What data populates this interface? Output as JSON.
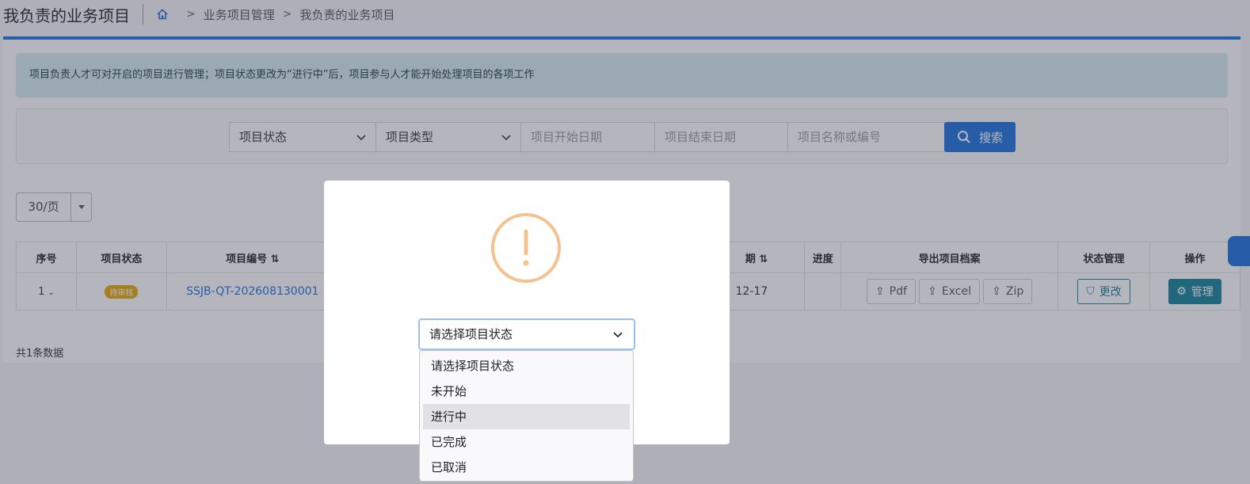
{
  "header": {
    "title": "我负责的业务项目",
    "breadcrumb": [
      "业务项目管理",
      "我负责的业务项目"
    ]
  },
  "notice": "项目负责人才可对开启的项目进行管理；项目状态更改为“进行中”后，项目参与人才能开始处理项目的各项工作",
  "filters": {
    "status_select": "项目状态",
    "type_select": "项目类型",
    "start_date_placeholder": "项目开始日期",
    "end_date_placeholder": "项目结束日期",
    "keyword_placeholder": "项目名称或编号",
    "search_label": "搜索"
  },
  "pagination": {
    "page_size": "30/页"
  },
  "table": {
    "headers": [
      "序号",
      "项目状态",
      "项目编号",
      "期",
      "进度",
      "导出项目档案",
      "状态管理",
      "操作"
    ],
    "rows": [
      {
        "index": "1",
        "status": "待审核",
        "code": "SSJB-QT-202608130001",
        "date_fragment": "12-17",
        "progress": "",
        "export_pdf": "Pdf",
        "export_excel": "Excel",
        "export_zip": "Zip",
        "state_button": "更改",
        "manage_button": "管理"
      }
    ],
    "total": "共1条数据"
  },
  "modal": {
    "select_value": "请选择项目状态",
    "options": [
      "请选择项目状态",
      "未开始",
      "进行中",
      "已完成",
      "已取消"
    ],
    "highlighted_option": "进行中"
  },
  "colors": {
    "primary": "#1b72d8",
    "teal": "#138496",
    "warning_icon": "#f5c190",
    "pending_badge": "#e6a800"
  }
}
